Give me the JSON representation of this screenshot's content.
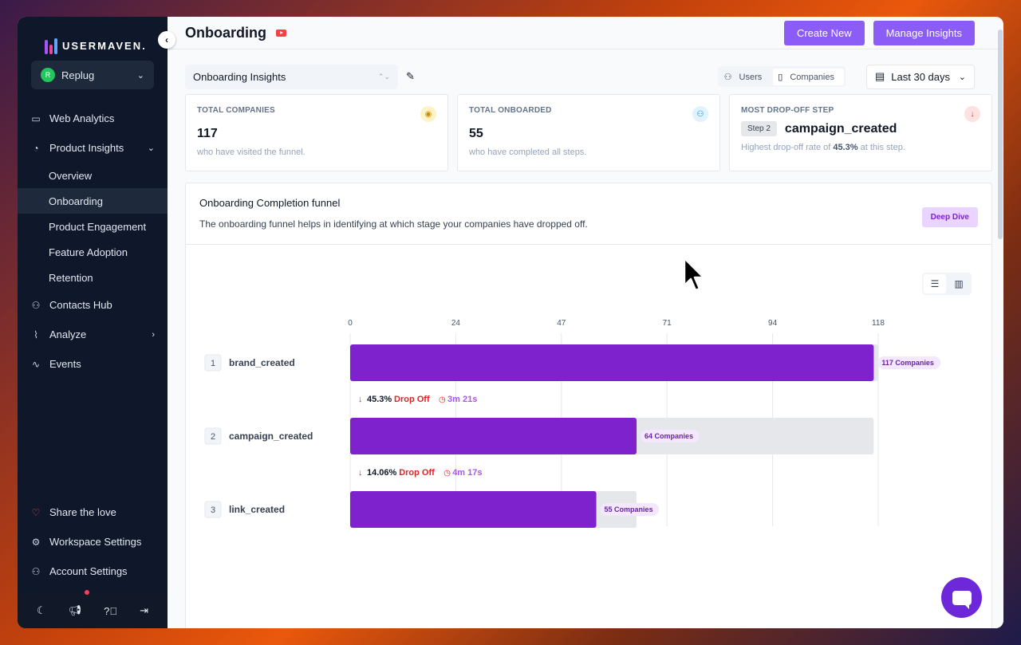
{
  "sidebar": {
    "brand": "USERMAVEN.",
    "workspace": {
      "initial": "R",
      "name": "Replug"
    },
    "items": [
      {
        "label": "Web Analytics",
        "icon": "browser-icon"
      },
      {
        "label": "Product Insights",
        "icon": "pie-chart-icon"
      },
      {
        "label": "Contacts Hub",
        "icon": "user-icon"
      },
      {
        "label": "Analyze",
        "icon": "line-chart-icon"
      },
      {
        "label": "Events",
        "icon": "activity-icon"
      }
    ],
    "sub_items": [
      "Overview",
      "Onboarding",
      "Product Engagement",
      "Feature Adoption",
      "Retention"
    ],
    "bottom_items": [
      {
        "label": "Share the love",
        "icon": "heart-icon"
      },
      {
        "label": "Workspace Settings",
        "icon": "gear-icon"
      },
      {
        "label": "Account Settings",
        "icon": "user-settings-icon"
      }
    ]
  },
  "header": {
    "title": "Onboarding",
    "create_new": "Create New",
    "manage_insights": "Manage Insights"
  },
  "filters": {
    "insight_select": "Onboarding Insights",
    "toggle_users": "Users",
    "toggle_companies": "Companies",
    "date_range": "Last 30 days"
  },
  "cards": [
    {
      "label": "TOTAL COMPANIES",
      "value": "117",
      "sub": "who have visited the funnel."
    },
    {
      "label": "TOTAL ONBOARDED",
      "value": "55",
      "sub": "who have completed all steps."
    },
    {
      "label": "MOST DROP-OFF STEP",
      "step_badge": "Step 2",
      "step_name": "campaign_created",
      "sub_prefix": "Highest drop-off rate of ",
      "sub_rate": "45.3%",
      "sub_suffix": " at this step."
    }
  ],
  "funnel": {
    "title": "Onboarding Completion funnel",
    "description": "The onboarding funnel helps in identifying at which stage your companies have dropped off.",
    "deep_dive": "Deep Dive"
  },
  "colors": {
    "accent": "#8b5cf6",
    "bar": "#7e22ce",
    "drop": "#dc2626"
  },
  "chart_data": {
    "type": "bar",
    "orientation": "horizontal",
    "axis_ticks": [
      0,
      24,
      47,
      71,
      94,
      118
    ],
    "xlim": [
      0,
      118
    ],
    "steps": [
      {
        "index": "1",
        "name": "brand_created",
        "value": 117,
        "label": "117 Companies"
      },
      {
        "index": "2",
        "name": "campaign_created",
        "value": 64,
        "label": "64 Companies"
      },
      {
        "index": "3",
        "name": "link_created",
        "value": 55,
        "label": "55 Companies"
      }
    ],
    "drop_offs": [
      {
        "rate": "45.3%",
        "text": "Drop Off",
        "time": "3m 21s"
      },
      {
        "rate": "14.06%",
        "text": "Drop Off",
        "time": "4m 17s"
      }
    ]
  }
}
